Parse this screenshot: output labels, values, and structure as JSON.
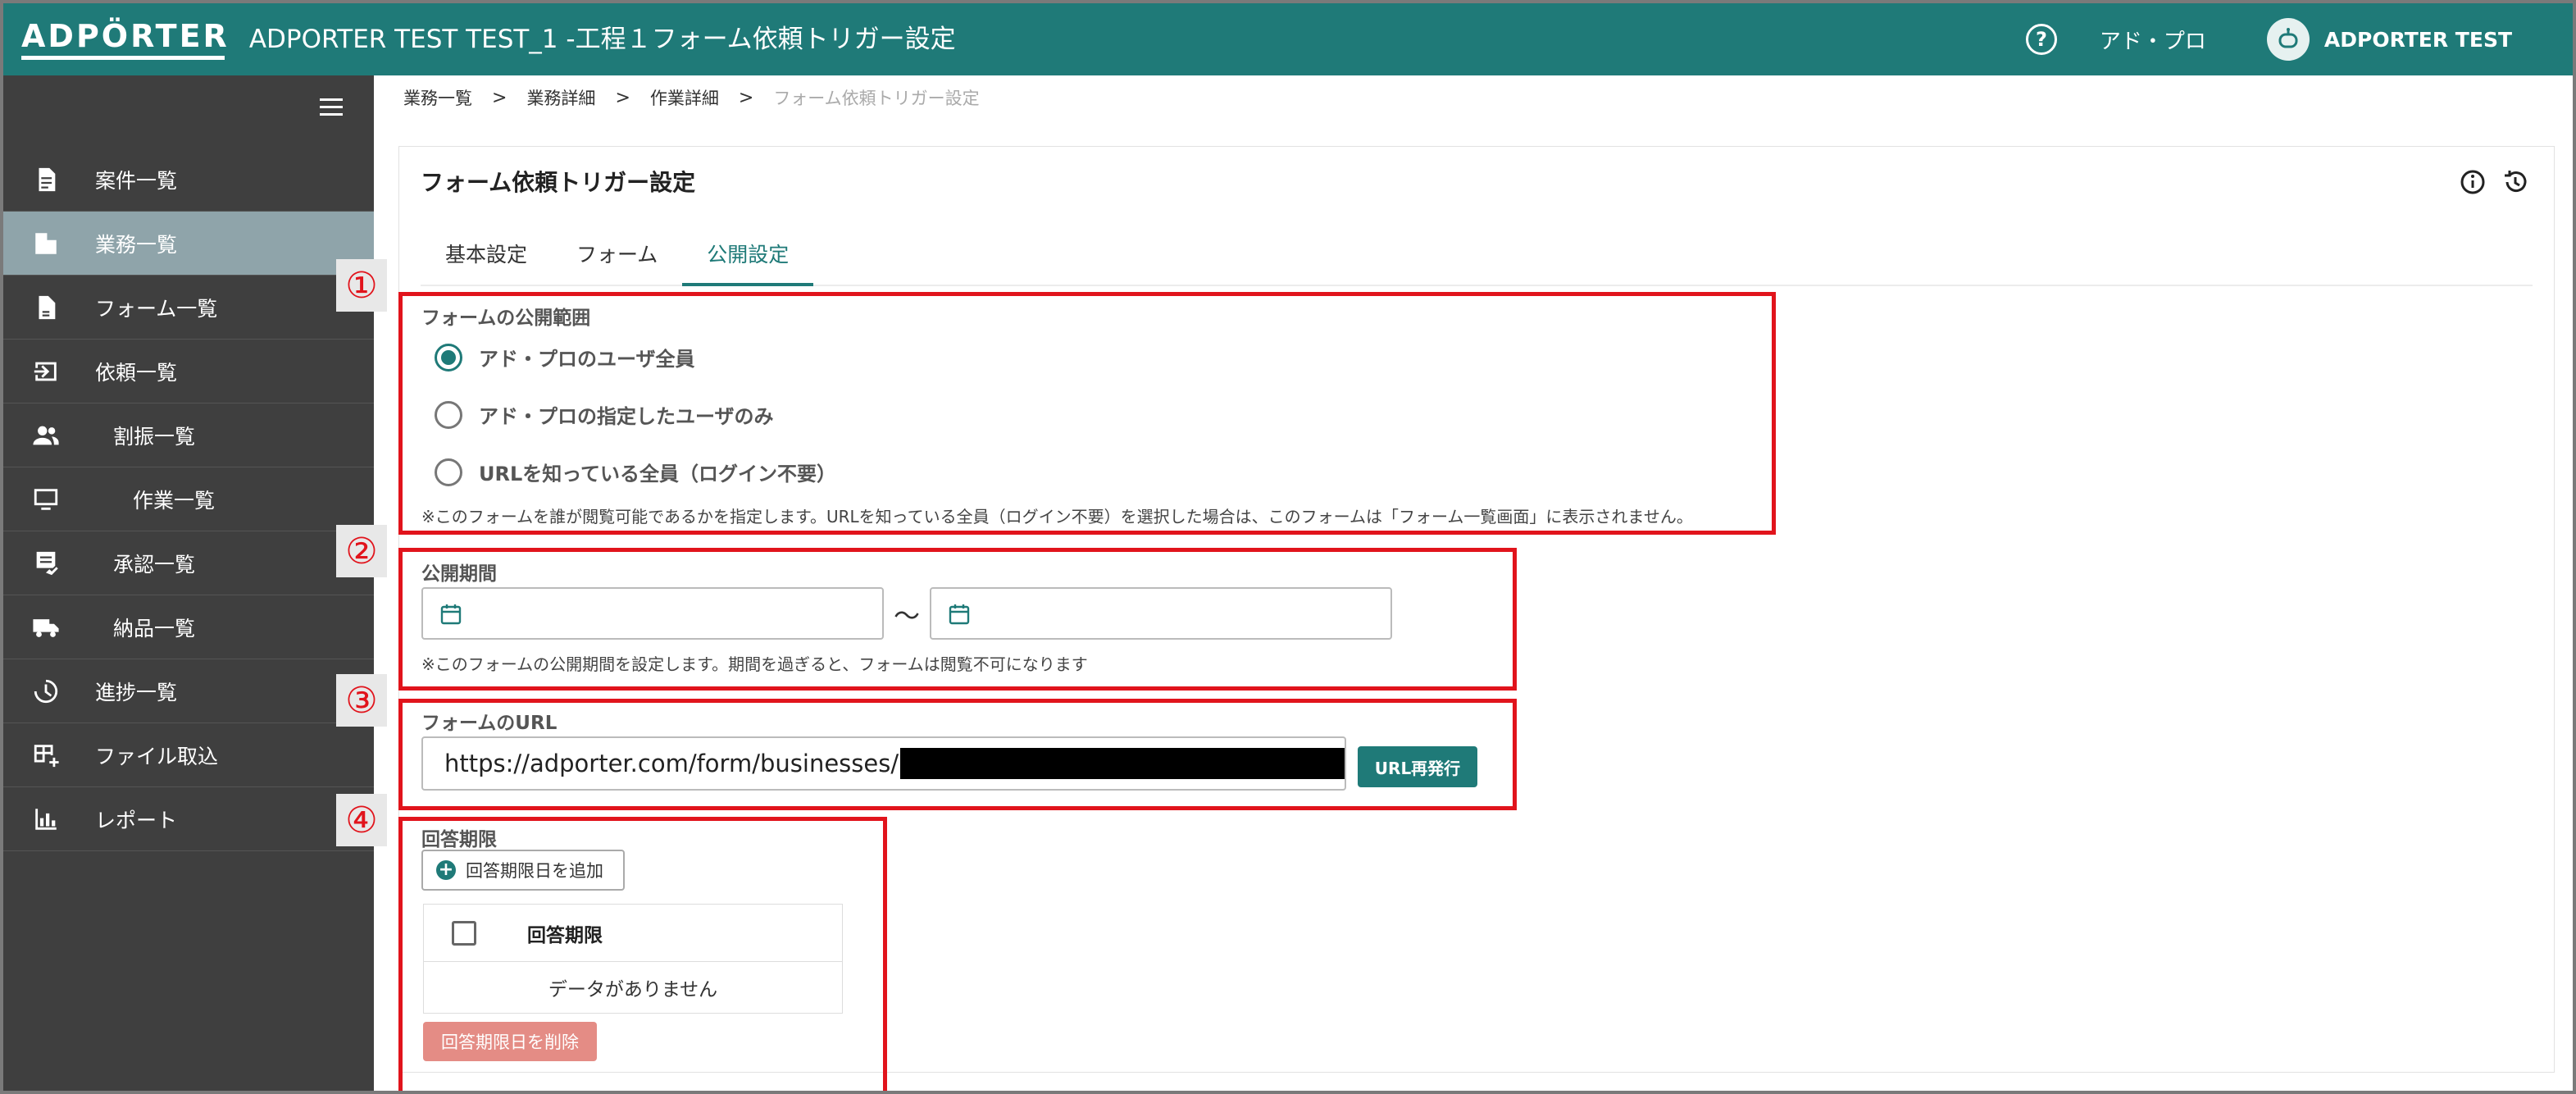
{
  "header": {
    "logo": "ADPÖRTER",
    "title": "ADPORTER TEST TEST_1 -工程１フォーム依頼トリガー設定",
    "help_icon_glyph": "?",
    "tenant": "アド・プロ",
    "user": "ADPORTER TEST"
  },
  "sidebar": {
    "items": [
      {
        "label": "案件一覧",
        "icon": "document-icon"
      },
      {
        "label": "業務一覧",
        "icon": "building-icon"
      },
      {
        "label": "フォーム一覧",
        "icon": "form-file-icon"
      },
      {
        "label": "依頼一覧",
        "icon": "inbox-arrow-icon"
      },
      {
        "label": "割振一覧",
        "icon": "people-icon"
      },
      {
        "label": "作業一覧",
        "icon": "monitor-icon"
      },
      {
        "label": "承認一覧",
        "icon": "approval-icon"
      },
      {
        "label": "納品一覧",
        "icon": "truck-icon"
      },
      {
        "label": "進捗一覧",
        "icon": "clock-icon"
      },
      {
        "label": "ファイル取込",
        "icon": "table-add-icon"
      },
      {
        "label": "レポート",
        "icon": "bar-chart-icon"
      }
    ],
    "active_index": 1
  },
  "breadcrumb": [
    "業務一覧",
    "業務詳細",
    "作業詳細",
    "フォーム依頼トリガー設定"
  ],
  "breadcrumb_sep": ">",
  "panel": {
    "title": "フォーム依頼トリガー設定",
    "tabs": [
      "基本設定",
      "フォーム",
      "公開設定"
    ],
    "active_tab": 2
  },
  "callouts": [
    "①",
    "②",
    "③",
    "④"
  ],
  "scope": {
    "label": "フォームの公開範囲",
    "options": [
      "アド・プロのユーザ全員",
      "アド・プロの指定したユーザのみ",
      "URLを知っている全員（ログイン不要）"
    ],
    "selected": 0,
    "note": "※このフォームを誰が閲覧可能であるかを指定します。URLを知っている全員（ログイン不要）を選択した場合は、このフォームは「フォーム一覧画面」に表示されません。"
  },
  "period": {
    "label": "公開期間",
    "start": "",
    "end": "",
    "separator": "〜",
    "note": "※このフォームの公開期間を設定します。期間を過ぎると、フォームは閲覧不可になります"
  },
  "url": {
    "label": "フォームのURL",
    "value_prefix": "https://adporter.com/form/businesses/",
    "reissue_label": "URL再発行"
  },
  "deadline": {
    "label": "回答期限",
    "add_label": "回答期限日を追加",
    "column": "回答期限",
    "empty": "データがありません",
    "delete_label": "回答期限日を削除"
  },
  "colors": {
    "accent": "#1f7a78",
    "sidebar": "#3f3f3f",
    "active_nav": "#8fa4aa",
    "callout": "#e1141c",
    "danger": "#e48c85"
  }
}
